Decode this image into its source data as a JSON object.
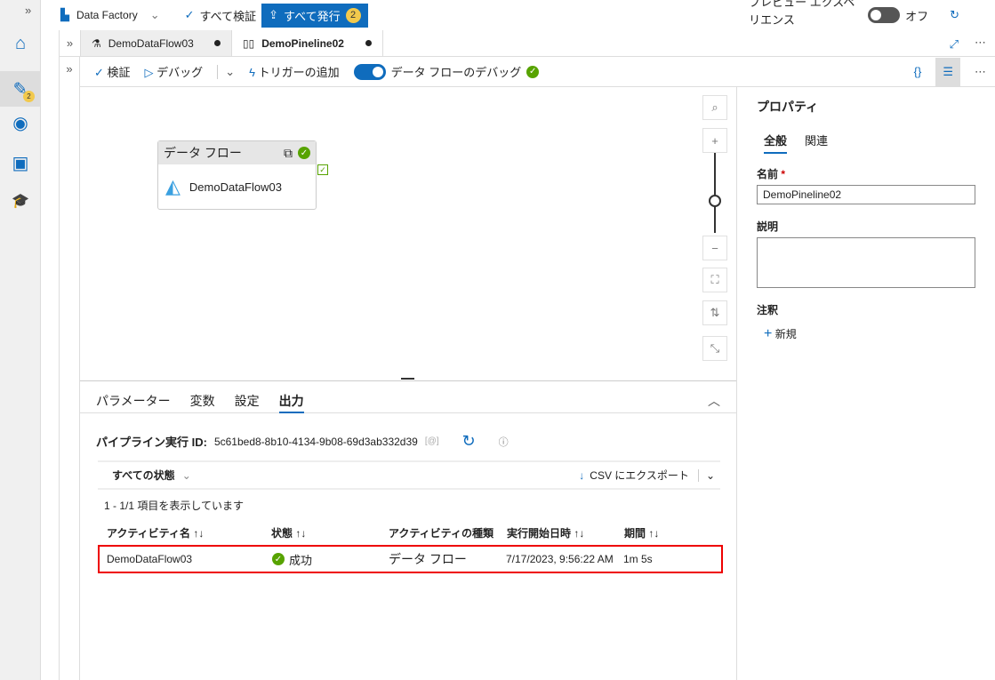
{
  "topbar": {
    "factory": "Data Factory",
    "validate_all": "すべて検証",
    "publish_all": "すべて発行",
    "publish_count": "2",
    "preview": "プレビュー エクスペリエンス",
    "preview_state": "オフ"
  },
  "rail": {
    "author_badge": "2"
  },
  "tabs": [
    {
      "label": "DemoDataFlow03"
    },
    {
      "label": "DemoPineline02"
    }
  ],
  "toolbar": {
    "validate": "検証",
    "debug": "デバッグ",
    "add_trigger": "トリガーの追加",
    "dataflow_debug": "データ フローのデバッグ"
  },
  "canvas": {
    "node_type": "データ フロー",
    "node_name": "DemoDataFlow03"
  },
  "properties": {
    "title": "プロパティ",
    "tabs": [
      "全般",
      "関連"
    ],
    "name_label": "名前",
    "name_value": "DemoPineline02",
    "desc_label": "説明",
    "annotation_label": "注釈",
    "new": "新規"
  },
  "bottom": {
    "tabs": [
      "パラメーター",
      "変数",
      "設定",
      "出力"
    ],
    "run_id_label": "パイプライン実行 ID:",
    "run_id": "5c61bed8-8b10-4134-9b08-69d3ab332d39",
    "filter": "すべての状態",
    "export": "CSV にエクスポート",
    "count": "1 - 1/1 項目を表示しています",
    "columns": [
      "アクティビティ名",
      "状態",
      "アクティビティの種類",
      "実行開始日時",
      "期間"
    ],
    "rows": [
      {
        "name": "DemoDataFlow03",
        "status": "成功",
        "type": "データ フロー",
        "start": "7/17/2023, 9:56:22 AM",
        "duration": "1m 5s"
      }
    ]
  }
}
